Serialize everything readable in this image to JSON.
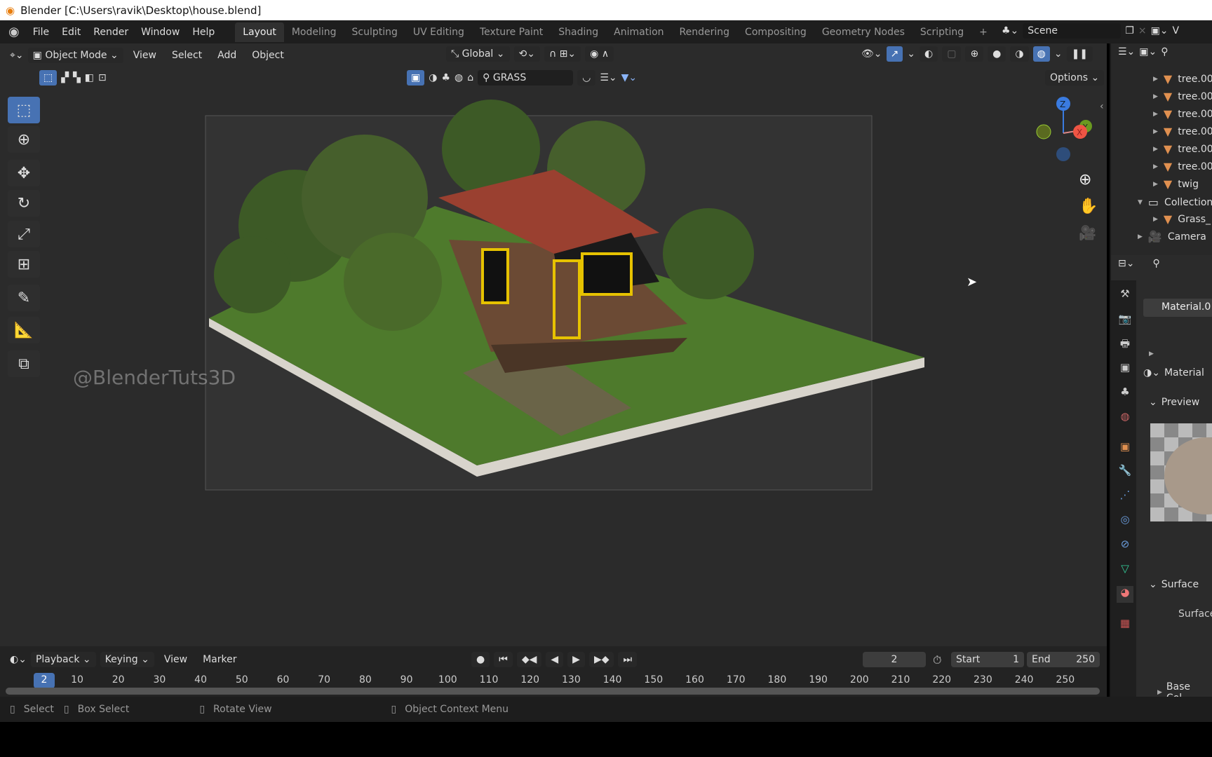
{
  "window_title": "Blender [C:\\Users\\ravik\\Desktop\\house.blend]",
  "menu": [
    "File",
    "Edit",
    "Render",
    "Window",
    "Help"
  ],
  "workspaces": [
    "Layout",
    "Modeling",
    "Sculpting",
    "UV Editing",
    "Texture Paint",
    "Shading",
    "Animation",
    "Rendering",
    "Compositing",
    "Geometry Nodes",
    "Scripting",
    "+"
  ],
  "active_workspace": "Layout",
  "scene": {
    "name": "Scene",
    "view_layer": "V"
  },
  "viewport": {
    "mode": "Object Mode",
    "menus": [
      "View",
      "Select",
      "Add",
      "Object"
    ],
    "orientation": "Global",
    "search_value": "GRASS",
    "options": "Options",
    "watermark": "@BlenderTuts3D",
    "gizmo": {
      "x": "X",
      "y": "Y",
      "z": "Z"
    }
  },
  "outliner": {
    "items": [
      {
        "label": "tree.00",
        "type": "mesh"
      },
      {
        "label": "tree.00",
        "type": "mesh"
      },
      {
        "label": "tree.00",
        "type": "mesh"
      },
      {
        "label": "tree.00",
        "type": "mesh"
      },
      {
        "label": "tree.00",
        "type": "mesh"
      },
      {
        "label": "tree.00",
        "type": "mesh"
      },
      {
        "label": "twig",
        "type": "mesh"
      },
      {
        "label": "Collection",
        "type": "collection"
      },
      {
        "label": "Grass_",
        "type": "mesh"
      },
      {
        "label": "Camera",
        "type": "camera"
      }
    ]
  },
  "properties": {
    "material_slot": "Material.0",
    "material_name": "Material",
    "preview": "Preview",
    "surface_panel": "Surface",
    "surface_label": "Surface",
    "base_color": "Base Col..."
  },
  "timeline": {
    "menus": [
      "Playback",
      "Keying",
      "View",
      "Marker"
    ],
    "current_frame": "2",
    "start_label": "Start",
    "start": "1",
    "end_label": "End",
    "end": "250",
    "ticks": [
      "10",
      "20",
      "30",
      "40",
      "50",
      "60",
      "70",
      "80",
      "90",
      "100",
      "110",
      "120",
      "130",
      "140",
      "150",
      "160",
      "170",
      "180",
      "190",
      "200",
      "210",
      "220",
      "230",
      "240",
      "250"
    ]
  },
  "status": {
    "select": "Select",
    "box_select": "Box Select",
    "rotate": "Rotate View",
    "context": "Object Context Menu"
  },
  "colors": {
    "accent": "#4772b3",
    "mesh": "#e09050"
  }
}
